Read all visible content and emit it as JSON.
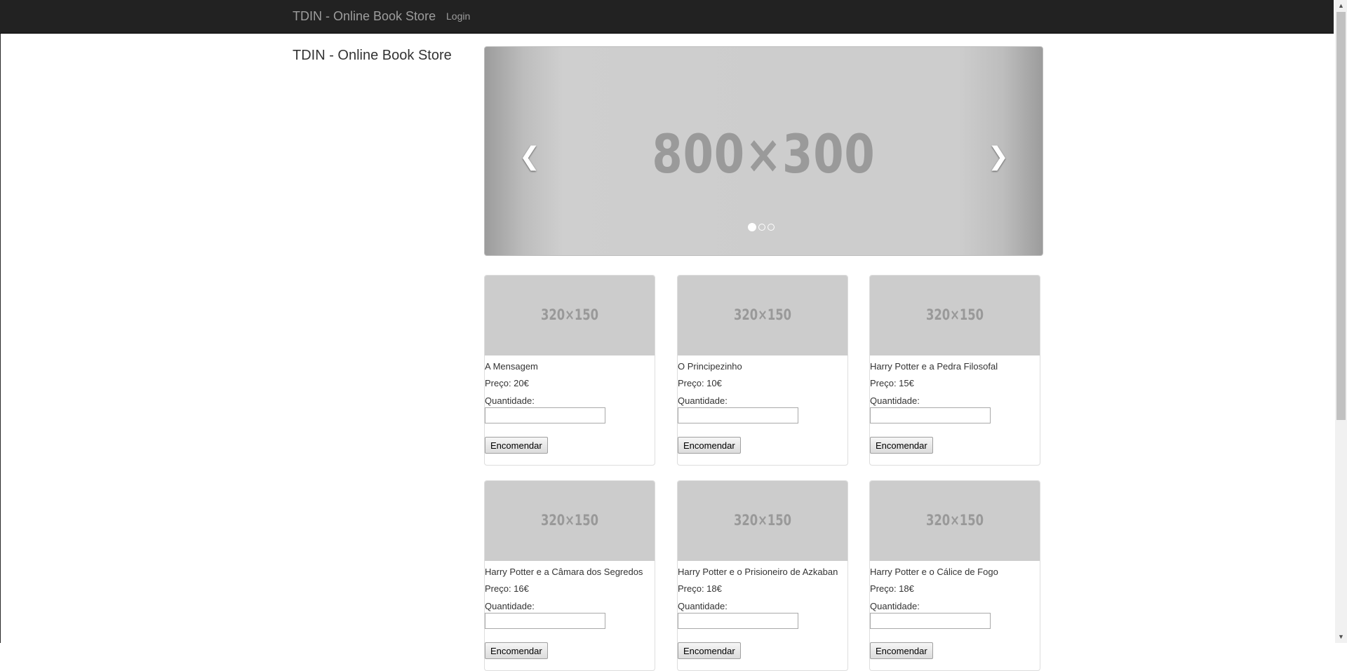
{
  "navbar": {
    "brand": "TDIN - Online Book Store",
    "login": "Login"
  },
  "sidebar": {
    "title": "TDIN - Online Book Store"
  },
  "carousel": {
    "placeholder_text": "800×300",
    "prev_icon": "chevron-left-icon",
    "next_icon": "chevron-right-icon",
    "active_slide": 1,
    "slide_count": 3
  },
  "products": [
    {
      "thumb_text": "320×150",
      "title": "A Mensagem",
      "price": "Preço: 20€",
      "qty_label": "Quantidade:",
      "qty_value": "",
      "button": "Encomendar"
    },
    {
      "thumb_text": "320×150",
      "title": "O Principezinho",
      "price": "Preço: 10€",
      "qty_label": "Quantidade:",
      "qty_value": "",
      "button": "Encomendar"
    },
    {
      "thumb_text": "320×150",
      "title": "Harry Potter e a Pedra Filosofal",
      "price": "Preço: 15€",
      "qty_label": "Quantidade:",
      "qty_value": "",
      "button": "Encomendar"
    },
    {
      "thumb_text": "320×150",
      "title": "Harry Potter e a Câmara dos Segredos",
      "price": "Preço: 16€",
      "qty_label": "Quantidade:",
      "qty_value": "",
      "button": "Encomendar"
    },
    {
      "thumb_text": "320×150",
      "title": "Harry Potter e o Prisioneiro de Azkaban",
      "price": "Preço: 18€",
      "qty_label": "Quantidade:",
      "qty_value": "",
      "button": "Encomendar"
    },
    {
      "thumb_text": "320×150",
      "title": "Harry Potter e o Cálice de Fogo",
      "price": "Preço: 18€",
      "qty_label": "Quantidade:",
      "qty_value": "",
      "button": "Encomendar"
    }
  ],
  "colors": {
    "navbar_bg": "#222222",
    "nav_text": "#9d9d9d",
    "placeholder_gray": "#cccccc"
  }
}
